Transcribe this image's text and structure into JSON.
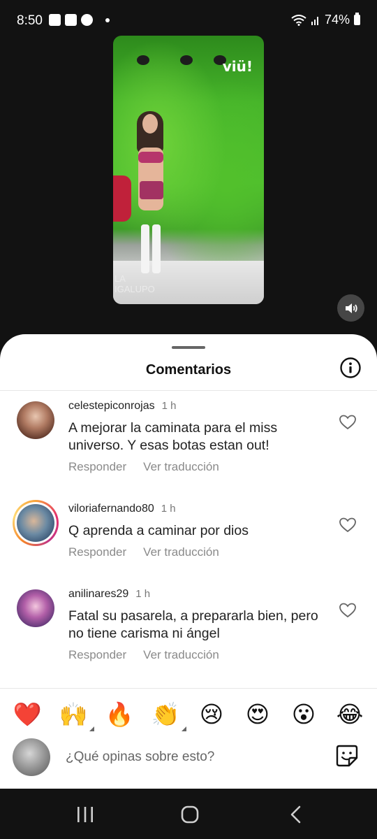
{
  "status_bar": {
    "time": "8:50",
    "battery": "74%"
  },
  "video": {
    "logo": "viü!",
    "caption_line1": "LA",
    "caption_line2": "IGALUPO"
  },
  "sheet": {
    "title": "Comentarios"
  },
  "comments": [
    {
      "username": "celestepiconrojas",
      "time": "1 h",
      "text": "A mejorar la caminata para el miss universo. Y esas botas estan out!",
      "reply_label": "Responder",
      "translate_label": "Ver traducción"
    },
    {
      "username": "viloriafernando80",
      "time": "1 h",
      "text": "Q aprenda a caminar por dios",
      "reply_label": "Responder",
      "translate_label": "Ver traducción"
    },
    {
      "username": "anilinares29",
      "time": "1 h",
      "text": "Fatal su pasarela, a prepararla bien, pero no tiene carisma ni ángel",
      "reply_label": "Responder",
      "translate_label": "Ver traducción"
    }
  ],
  "quick_reactions": [
    "❤️",
    "🙌",
    "🔥",
    "👏",
    "😢",
    "😍",
    "😮",
    "😂"
  ],
  "comment_box": {
    "placeholder": "¿Qué opinas sobre esto?"
  },
  "colors": {
    "background": "#121212",
    "sheet": "#ffffff",
    "muted_text": "#8a8a8a",
    "story_ring": "#e3306c"
  },
  "icons": [
    "image-icon",
    "pinterest-icon",
    "wifi-icon",
    "signal-icon",
    "battery-icon",
    "volume-icon",
    "info-icon",
    "heart-icon",
    "sticker-icon",
    "recents-icon",
    "home-icon",
    "back-icon"
  ]
}
